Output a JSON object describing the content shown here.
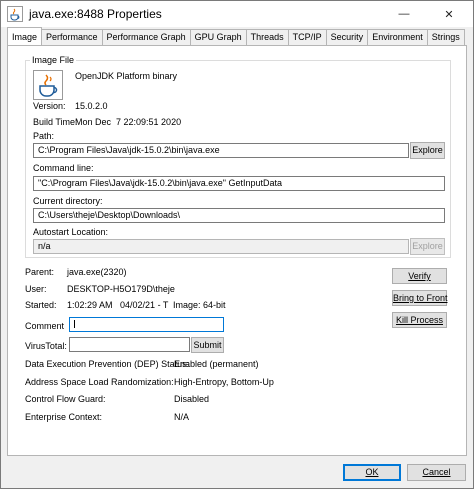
{
  "window": {
    "title": "java.exe:8488 Properties",
    "app_icon": "java-cup-icon",
    "controls": {
      "minimize": "—",
      "close": "✕"
    }
  },
  "tabs": [
    "Image",
    "Performance",
    "Performance Graph",
    "GPU Graph",
    "Threads",
    "TCP/IP",
    "Security",
    "Environment",
    "Strings"
  ],
  "image_file": {
    "legend": "Image File",
    "icon": "java-cup-icon",
    "description": "OpenJDK Platform binary",
    "version_label": "Version:",
    "version": "15.0.2.0",
    "build_time_label": "Build Time:",
    "build_time": "Mon Dec  7 22:09:51 2020",
    "path_label": "Path:",
    "path": "C:\\Program Files\\Java\\jdk-15.0.2\\bin\\java.exe",
    "explore_label": "Explore",
    "command_line_label": "Command line:",
    "command_line": "\"C:\\Program Files\\Java\\jdk-15.0.2\\bin\\java.exe\" GetInputData",
    "current_directory_label": "Current directory:",
    "current_directory": "C:\\Users\\theje\\Desktop\\Downloads\\",
    "autostart_label": "Autostart Location:",
    "autostart": "n/a",
    "explore_disabled_label": "Explore"
  },
  "process": {
    "parent_label": "Parent:",
    "parent": "java.exe(2320)",
    "user_label": "User:",
    "user": "DESKTOP-H5O179D\\theje",
    "started_label": "Started:",
    "started": "1:02:29 AM   04/02/21 - T",
    "image_type": "Image: 64-bit",
    "comment_label": "Comment",
    "comment_value": "",
    "virustotal_label": "VirusTotal:",
    "virustotal_value": "",
    "submit_label": "Submit"
  },
  "actions": {
    "verify": "Verify",
    "bring_to_front": "Bring to Front",
    "kill_process": "Kill Process"
  },
  "security": {
    "dep_label": "Data Execution Prevention (DEP) Status:",
    "dep": "Enabled (permanent)",
    "aslr_label": "Address Space Load Randomization:",
    "aslr": "High-Entropy, Bottom-Up",
    "cfg_label": "Control Flow Guard:",
    "cfg": "Disabled",
    "enterprise_label": "Enterprise Context:",
    "enterprise": "N/A"
  },
  "footer": {
    "ok": "OK",
    "cancel": "Cancel"
  }
}
